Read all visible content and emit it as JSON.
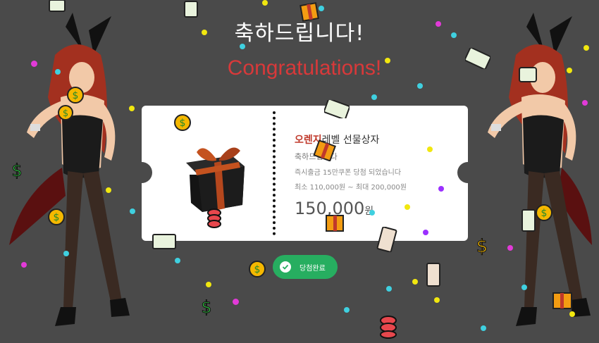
{
  "header": {
    "title_ko": "축하드립니다!",
    "title_en": "Congratulations!"
  },
  "ticket": {
    "grade_highlight": "오렌지",
    "grade_rest": "레벨 선물상자",
    "line_subtitle": "축하드립니다",
    "line_notice": "즉시출금 15만쿠폰 당첨 되었습니다",
    "line_range": "최소 110,000원 ~ 최대 200,000원",
    "amount": "150,000",
    "amount_unit": "원"
  },
  "button": {
    "label": "당첨완료"
  },
  "colors": {
    "background": "#4a4a4a",
    "title_en": "#d8393a",
    "highlight": "#c0392b",
    "button": "#27ae60"
  },
  "icons": [
    "gift-box-icon",
    "checkmark-icon",
    "money-bag-icon",
    "dollar-bill-icon",
    "present-icon",
    "character-illustration"
  ]
}
